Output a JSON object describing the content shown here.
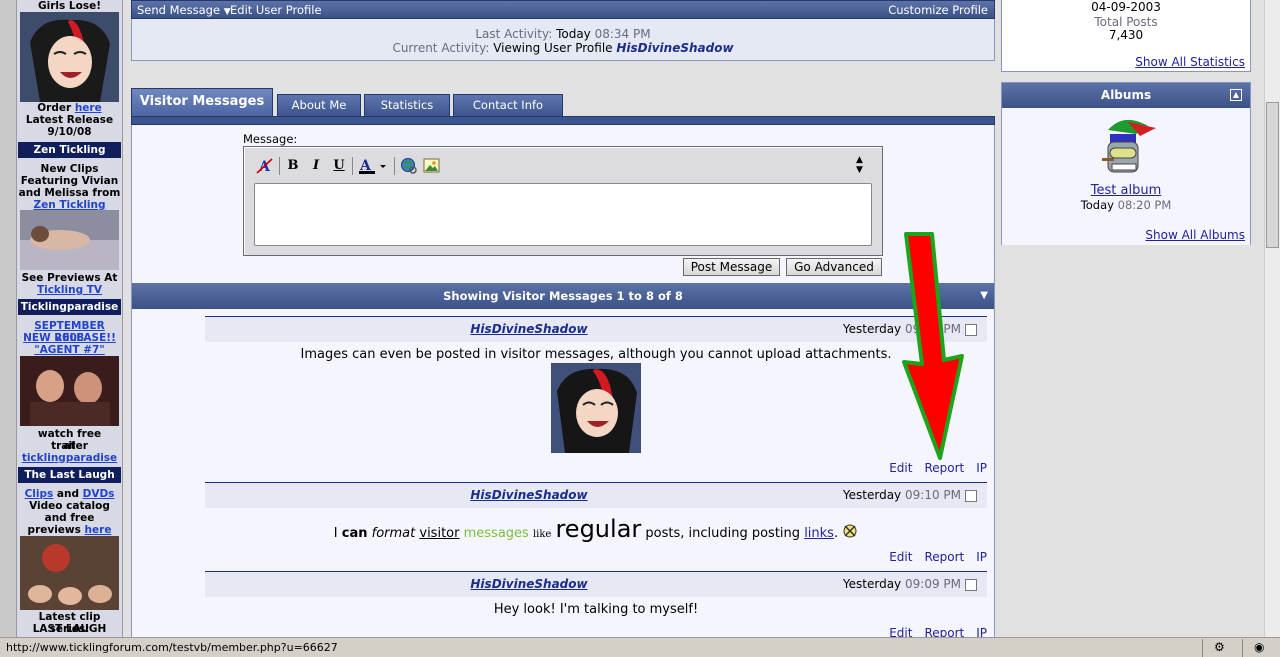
{
  "sidebar": {
    "block1": {
      "line1": "Girls Lose!",
      "order_prefix": "Order",
      "order_link": "here",
      "release_label": "Latest Release",
      "release_date": "9/10/08"
    },
    "block2": {
      "header": "Zen Tickling",
      "line1": "New Clips",
      "line2": "Featuring Vivian",
      "line3": "and Melissa from",
      "link1": "Zen Tickling",
      "line4": "See Previews At",
      "link2": "Tickling TV"
    },
    "block3": {
      "header": "Ticklingparadise",
      "link1": "SEPTEMBER 2008",
      "link2": "NEW RELEASE!!",
      "link3": "\"AGENT #7\"",
      "line1": "watch free trailer",
      "line2": "at",
      "link4": "ticklingparadise"
    },
    "block4": {
      "header": "The Last Laugh",
      "link1": "Clips",
      "and": "and",
      "link2": "DVDs",
      "line1": "Video catalog",
      "line2": "and free",
      "line3_prefix": "previews",
      "link3": "here",
      "line4": "Latest clip series:",
      "line5": "LAST LAUGH"
    }
  },
  "profile_bar": {
    "send_message": "Send Message",
    "edit_profile": "Edit User Profile",
    "customize": "Customize Profile"
  },
  "activity": {
    "last_label": "Last Activity:",
    "last_value": "Today",
    "last_time": "08:34 PM",
    "current_label": "Current Activity:",
    "current_value": "Viewing User Profile",
    "current_user": "HisDivineShadow"
  },
  "tabs": [
    "Visitor Messages",
    "About Me",
    "Statistics",
    "Contact Info"
  ],
  "editor": {
    "label": "Message:",
    "post_button": "Post Message",
    "advanced_button": "Go Advanced"
  },
  "messages_header": "Showing Visitor Messages 1 to 8 of 8",
  "messages": [
    {
      "author": "HisDivineShadow",
      "date": "Yesterday",
      "time": "09:12 PM",
      "body": "Images can even be posted in visitor messages, although you cannot upload attachments."
    },
    {
      "author": "HisDivineShadow",
      "date": "Yesterday",
      "time": "09:10 PM",
      "b1": "I",
      "b2": "can",
      "b3": "format",
      "b4": "visitor",
      "b5": "messages",
      "b6": "like",
      "b7": "regular",
      "b8": "posts, including posting",
      "b9": "links",
      "b10": "."
    },
    {
      "author": "HisDivineShadow",
      "date": "Yesterday",
      "time": "09:09 PM",
      "body": "Hey look! I'm talking to myself!"
    }
  ],
  "actions": {
    "edit": "Edit",
    "report": "Report",
    "ip": "IP"
  },
  "stats": {
    "join_date": "04-09-2003",
    "total_posts_label": "Total Posts",
    "total_posts": "7,430",
    "show_all": "Show All Statistics"
  },
  "albums": {
    "header": "Albums",
    "album_name": "Test album",
    "album_date": "Today",
    "album_time": "08:20 PM",
    "show_all": "Show All Albums"
  },
  "status_bar": {
    "url": "http://www.ticklingforum.com/testvb/member.php?u=66627"
  },
  "colors": {
    "header_blue": "#3b5288",
    "panel": "#f5f5ff",
    "arrow_red": "#ff0000",
    "arrow_green": "#20a020"
  }
}
